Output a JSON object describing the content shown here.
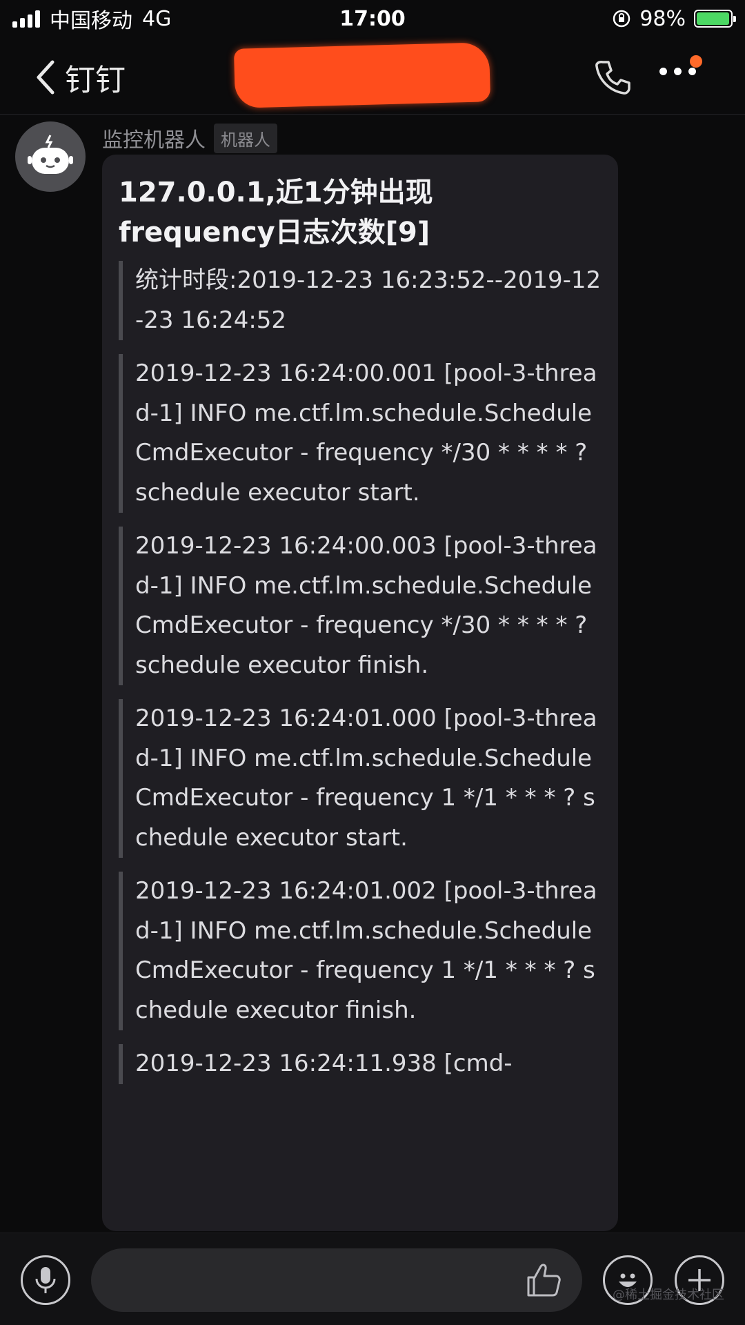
{
  "status_bar": {
    "carrier": "中国移动",
    "network": "4G",
    "time": "17:00",
    "battery_percent": "98%",
    "battery_level": 0.98
  },
  "nav": {
    "back_label": "钉钉",
    "back_icon": "chevron-left-icon",
    "call_icon": "phone-icon",
    "more_icon": "more-dots-icon",
    "redaction_color": "#ff4d1c"
  },
  "message": {
    "sender_name": "监控机器人",
    "sender_tag": "机器人",
    "avatar_icon": "robot-icon",
    "title": "127.0.0.1,近1分钟出现\nfrequency日志次数[9]",
    "quotes": [
      "统计时段:2019-12-23 16:23:52--2019-12-23 16:24:52",
      "2019-12-23 16:24:00.001 [pool-3-thread-1] INFO me.ctf.lm.schedule.ScheduleCmdExecutor - frequency */30 * * * * ? schedule executor start.",
      "2019-12-23 16:24:00.003 [pool-3-thread-1] INFO me.ctf.lm.schedule.ScheduleCmdExecutor - frequency */30 * * * * ? schedule executor finish.",
      "2019-12-23 16:24:01.000 [pool-3-thread-1] INFO me.ctf.lm.schedule.ScheduleCmdExecutor - frequency 1 */1 * * * ? schedule executor start.",
      "2019-12-23 16:24:01.002 [pool-3-thread-1] INFO me.ctf.lm.schedule.ScheduleCmdExecutor - frequency 1 */1 * * * ? schedule executor finish.",
      "2019-12-23 16:24:11.938 [cmd-"
    ]
  },
  "input_bar": {
    "mic_icon": "microphone-icon",
    "like_icon": "thumbs-up-icon",
    "emoji_icon": "smiley-icon",
    "plus_icon": "plus-icon",
    "watermark": "@稀土掘金技术社区"
  }
}
